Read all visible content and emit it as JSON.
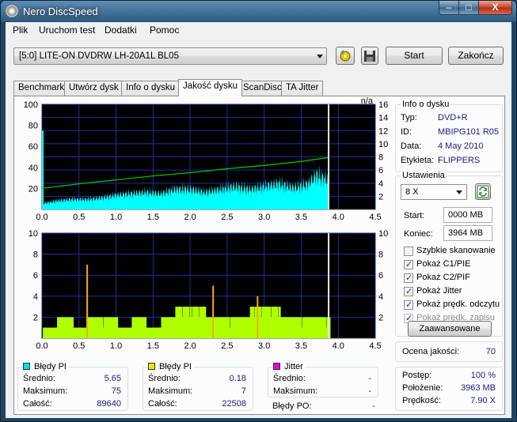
{
  "window": {
    "title": "Nero DiscSpeed"
  },
  "window_controls": {
    "minimize": "–",
    "maximize": "□",
    "close": "X"
  },
  "menu": [
    "Plik",
    "Uruchom test",
    "Dodatki",
    "Pomoc"
  ],
  "toolbar": {
    "drive": "[5:0]  LITE-ON DVDRW LH-20A1L BL05",
    "start_label": "Start",
    "end_label": "Zakończ"
  },
  "tabs": [
    "Benchmark",
    "Utwórz dysk",
    "Info o dysku",
    "Jakość dysku",
    "ScanDisc",
    "TA Jitter"
  ],
  "active_tab": "Jakość dysku",
  "disc_info": {
    "title": "Info o dysku",
    "type_label": "Typ:",
    "type": "DVD+R",
    "id_label": "ID:",
    "id": "MBIPG101 R05",
    "date_label": "Data:",
    "date": "4 May 2010",
    "label_label": "Etykieta:",
    "label": "FLIPPERS"
  },
  "settings": {
    "title": "Ustawienia",
    "speed": "8 X",
    "start_label": "Start:",
    "start": "0000 MB",
    "end_label": "Koniec:",
    "end": "3964 MB",
    "options": [
      {
        "label": "Szybkie skanowanie",
        "checked": false,
        "enabled": true
      },
      {
        "label": "Pokaż C1/PIE",
        "checked": true,
        "enabled": true
      },
      {
        "label": "Pokaż C2/PIF",
        "checked": true,
        "enabled": true
      },
      {
        "label": "Pokaż Jitter",
        "checked": true,
        "enabled": true
      },
      {
        "label": "Pokaż prędk. odczytu",
        "checked": true,
        "enabled": true
      },
      {
        "label": "Pokaż prędk. zapisu",
        "checked": true,
        "enabled": false
      }
    ],
    "advanced_label": "Zaawansowane"
  },
  "quality": {
    "label": "Ocena jakości:",
    "value": "70"
  },
  "progress": {
    "progress_label": "Postęp:",
    "progress": "100 %",
    "position_label": "Położenie:",
    "position": "3963 MB",
    "speed_label": "Prędkość:",
    "speed": "7.90 X"
  },
  "stats": {
    "pi": {
      "title": "Błędy PI",
      "color": "#00e0e0",
      "avg_label": "Średnio:",
      "avg": "5.65",
      "max_label": "Maksimum:",
      "max": "75",
      "total_label": "Całość:",
      "total": "89640"
    },
    "pif": {
      "title": "Błędy PI",
      "color": "#e8e800",
      "avg_label": "Średnio:",
      "avg": "0.18",
      "max_label": "Maksimum:",
      "max": "7",
      "total_label": "Całość:",
      "total": "22508"
    },
    "jitter": {
      "title": "Jitter",
      "color": "#e000e0",
      "avg_label": "Średnio:",
      "avg": "-",
      "max_label": "Maksimum:",
      "max": "-",
      "po_label": "Błędy PO:",
      "po": "-"
    }
  },
  "chart_data": [
    {
      "type": "area",
      "title": "",
      "xlabel": "",
      "ylabel": "",
      "xlim": [
        0,
        4.5
      ],
      "ylim": [
        0,
        100
      ],
      "y2lim": [
        0,
        16
      ],
      "y2_top_label": "n/a",
      "x_ticks": [
        "0.0",
        "0.5",
        "1.0",
        "1.5",
        "2.0",
        "2.5",
        "3.0",
        "3.5",
        "4.0",
        "4.5"
      ],
      "y_ticks": [
        "20",
        "40",
        "60",
        "80",
        "100"
      ],
      "y2_ticks": [
        "2",
        "4",
        "6",
        "8",
        "10",
        "12",
        "14",
        "16"
      ],
      "grid": true,
      "series": [
        {
          "color": "#00ffff",
          "x": [
            0.0,
            0.2,
            0.4,
            0.6,
            0.8,
            1.0,
            1.2,
            1.4,
            1.6,
            1.8,
            2.0,
            2.2,
            2.4,
            2.6,
            2.8,
            3.0,
            3.2,
            3.4,
            3.6,
            3.7,
            3.8,
            3.87
          ],
          "y": [
            4,
            6,
            7,
            7,
            8,
            10,
            11,
            12,
            11,
            14,
            14,
            12,
            14,
            16,
            14,
            16,
            18,
            15,
            18,
            24,
            22,
            20
          ]
        },
        {
          "color": "#00c000",
          "x": [
            0.0,
            0.5,
            1.0,
            1.5,
            2.0,
            2.5,
            3.0,
            3.5,
            3.87
          ],
          "y": [
            3.2,
            3.9,
            4.5,
            5.1,
            5.6,
            6.2,
            6.7,
            7.3,
            7.9
          ]
        }
      ]
    },
    {
      "type": "bar",
      "title": "",
      "xlabel": "",
      "ylabel": "",
      "xlim": [
        0,
        4.5
      ],
      "ylim": [
        0,
        10
      ],
      "y2lim": [
        0,
        10
      ],
      "x_ticks": [
        "0.0",
        "0.5",
        "1.0",
        "1.5",
        "2.0",
        "2.5",
        "3.0",
        "3.5",
        "4.0",
        "4.5"
      ],
      "y_ticks": [
        "2",
        "4",
        "6",
        "8",
        "10"
      ],
      "y2_ticks": [
        "2",
        "4",
        "6",
        "8",
        "10"
      ],
      "grid": true,
      "series": [
        {
          "color": "#b0ff00",
          "x": [
            0.0,
            0.2,
            0.4,
            0.6,
            0.8,
            1.0,
            1.2,
            1.4,
            1.6,
            1.8,
            2.0,
            2.2,
            2.4,
            2.6,
            2.8,
            3.0,
            3.2,
            3.4,
            3.6,
            3.87
          ],
          "y": [
            1,
            2,
            1,
            2,
            2,
            1,
            2,
            1,
            2,
            3,
            3,
            2,
            2,
            2,
            3,
            3,
            2,
            2,
            2,
            1
          ]
        },
        {
          "color": "#f0b000",
          "x": [
            0.6,
            2.3,
            2.9
          ],
          "y": [
            7,
            5,
            4
          ]
        }
      ]
    }
  ]
}
